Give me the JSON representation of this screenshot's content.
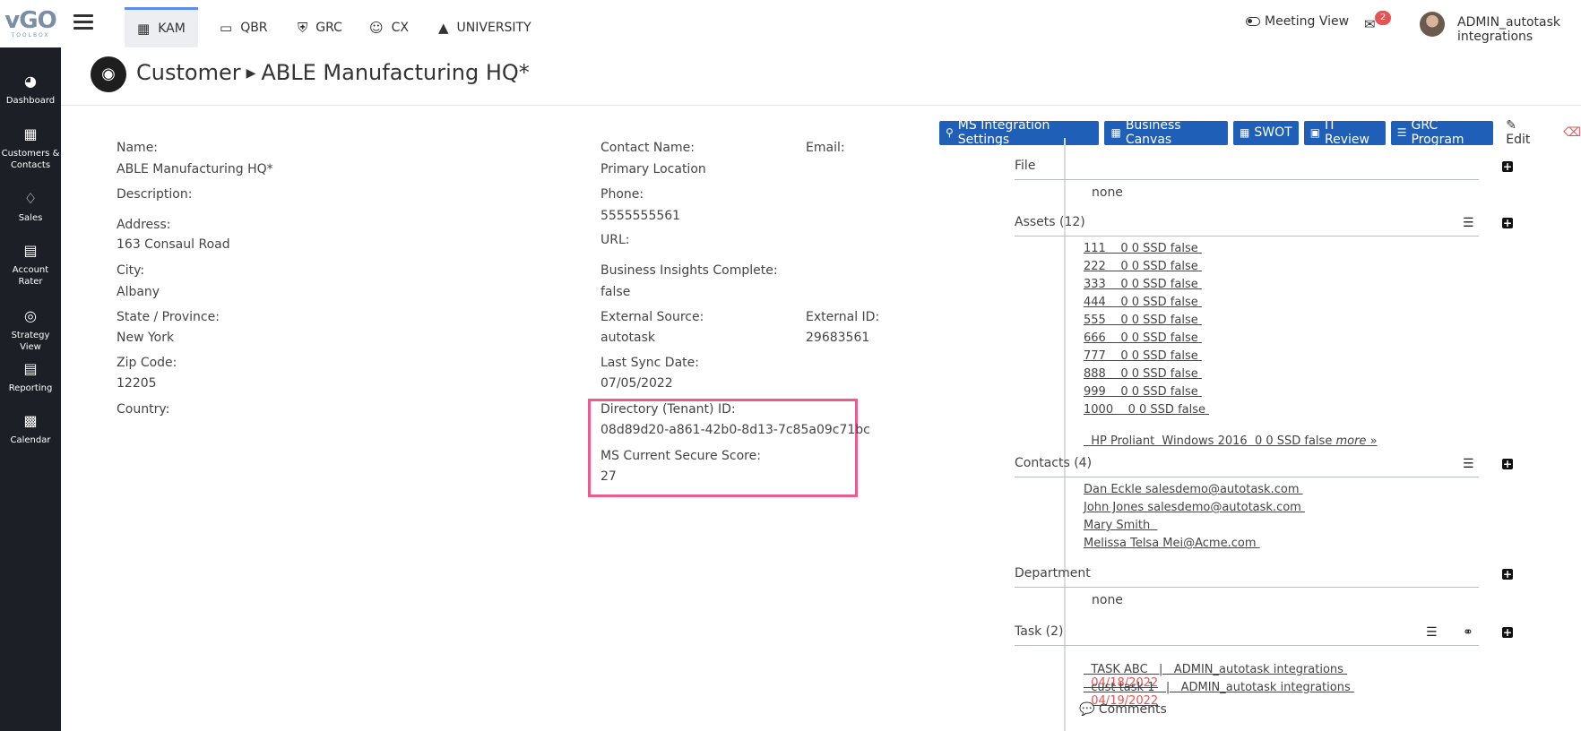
{
  "logo": {
    "main": "vGO",
    "sub": "TOOLBOX"
  },
  "sidebar": {
    "items": [
      {
        "label": "Dashboard",
        "icon": "speedometer-icon"
      },
      {
        "label": "Customers & Contacts",
        "icon": "id-card-icon"
      },
      {
        "label": "Sales",
        "icon": "bell-icon"
      },
      {
        "label": "Account Rater",
        "icon": "newspaper-icon"
      },
      {
        "label": "Strategy View",
        "icon": "target-icon"
      },
      {
        "label": "Reporting",
        "icon": "newspaper-icon"
      },
      {
        "label": "Calendar",
        "icon": "calendar-icon"
      }
    ]
  },
  "topbar": {
    "tabs": [
      {
        "label": "KAM",
        "icon": "id-card-icon",
        "active": true
      },
      {
        "label": "QBR",
        "icon": "laptop-icon",
        "active": false
      },
      {
        "label": "GRC",
        "icon": "shield-icon",
        "active": false
      },
      {
        "label": "CX",
        "icon": "smiley-icon",
        "active": false
      },
      {
        "label": "UNIVERSITY",
        "icon": "graduation-cap-icon",
        "active": false
      }
    ],
    "meeting_view": "Meeting View",
    "mail_count": "2",
    "username": "ADMIN_autotask integrations"
  },
  "page": {
    "breadcrumb_root": "Customer",
    "title": "ABLE Manufacturing HQ*"
  },
  "actions": {
    "ms_integration": "MS Integration Settings",
    "business_canvas": "Business Canvas",
    "swot": "SWOT",
    "it_review": "IT Review",
    "grc_program": "GRC Program",
    "edit": "Edit"
  },
  "fields": {
    "name_label": "Name:",
    "name_value": "ABLE Manufacturing HQ*",
    "description_label": "Description:",
    "address_label": "Address:",
    "address_value": "163 Consaul Road",
    "city_label": "City:",
    "city_value": "Albany",
    "state_label": "State / Province:",
    "state_value": "New York",
    "zip_label": "Zip Code:",
    "zip_value": "12205",
    "country_label": "Country:",
    "contact_label": "Contact Name:",
    "contact_value": "Primary Location",
    "email_label": "Email:",
    "phone_label": "Phone:",
    "phone_value": "5555555561",
    "url_label": "URL:",
    "insights_label": "Business Insights Complete:",
    "insights_value": "false",
    "ext_source_label": "External Source:",
    "ext_source_value": "autotask",
    "ext_id_label": "External ID:",
    "ext_id_value": "29683561",
    "last_sync_label": "Last Sync Date:",
    "last_sync_value": "07/05/2022",
    "tenant_label": "Directory (Tenant) ID:",
    "tenant_value": "08d89d20-a861-42b0-8d13-7c85a09c71bc",
    "secure_label": "MS Current Secure Score:",
    "secure_value": "27"
  },
  "panels": {
    "file": {
      "title": "File",
      "empty": "none"
    },
    "assets": {
      "title": "Assets (12)",
      "items": [
        "111    0 0 SSD false ",
        "222    0 0 SSD false ",
        "333    0 0 SSD false ",
        "444    0 0 SSD false ",
        "555    0 0 SSD false ",
        "666    0 0 SSD false ",
        "777    0 0 SSD false ",
        "888    0 0 SSD false ",
        "999    0 0 SSD false ",
        "1000    0 0 SSD false "
      ],
      "last_item": "HP Proliant  Windows 2016  0 0 SSD false ",
      "more": "more"
    },
    "contacts": {
      "title": "Contacts (4)",
      "items": [
        "Dan Eckle salesdemo@autotask.com ",
        "John Jones salesdemo@autotask.com ",
        "Mary Smith  ",
        "Melissa Telsa Mei@Acme.com "
      ]
    },
    "department": {
      "title": "Department",
      "empty": "none"
    },
    "task": {
      "title": "Task (2)",
      "items": [
        {
          "text": "TASK ABC   |   ADMIN_autotask integrations ",
          "date": "04/18/2022"
        },
        {
          "text": "cust task 1   |   ADMIN_autotask integrations ",
          "date": "04/19/2022"
        }
      ]
    },
    "comments": {
      "title": "Comments"
    }
  },
  "colors": {
    "accent": "#1f5fb8",
    "sidebar": "#1c1f26",
    "highlight": "#ec5b8f",
    "danger": "#e55353"
  }
}
